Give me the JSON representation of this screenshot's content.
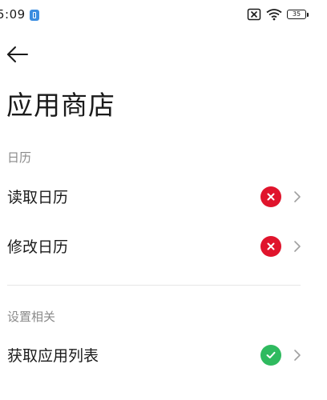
{
  "status_bar": {
    "time": "5:09",
    "battery_level": "35"
  },
  "header": {
    "title": "应用商店"
  },
  "sections": [
    {
      "title": "日历",
      "items": [
        {
          "label": "读取日历",
          "state": "denied"
        },
        {
          "label": "修改日历",
          "state": "denied"
        }
      ]
    },
    {
      "title": "设置相关",
      "items": [
        {
          "label": "获取应用列表",
          "state": "allowed"
        }
      ]
    }
  ],
  "colors": {
    "denied": "#e0142c",
    "allowed": "#2fba5f",
    "chevron": "#a0a0a0",
    "section_header": "#8a8a8a",
    "divider": "#e6e6e6"
  },
  "icons": {
    "back": "arrow-left-icon",
    "denied": "close-icon",
    "allowed": "check-icon",
    "chevron": "chevron-right-icon"
  }
}
